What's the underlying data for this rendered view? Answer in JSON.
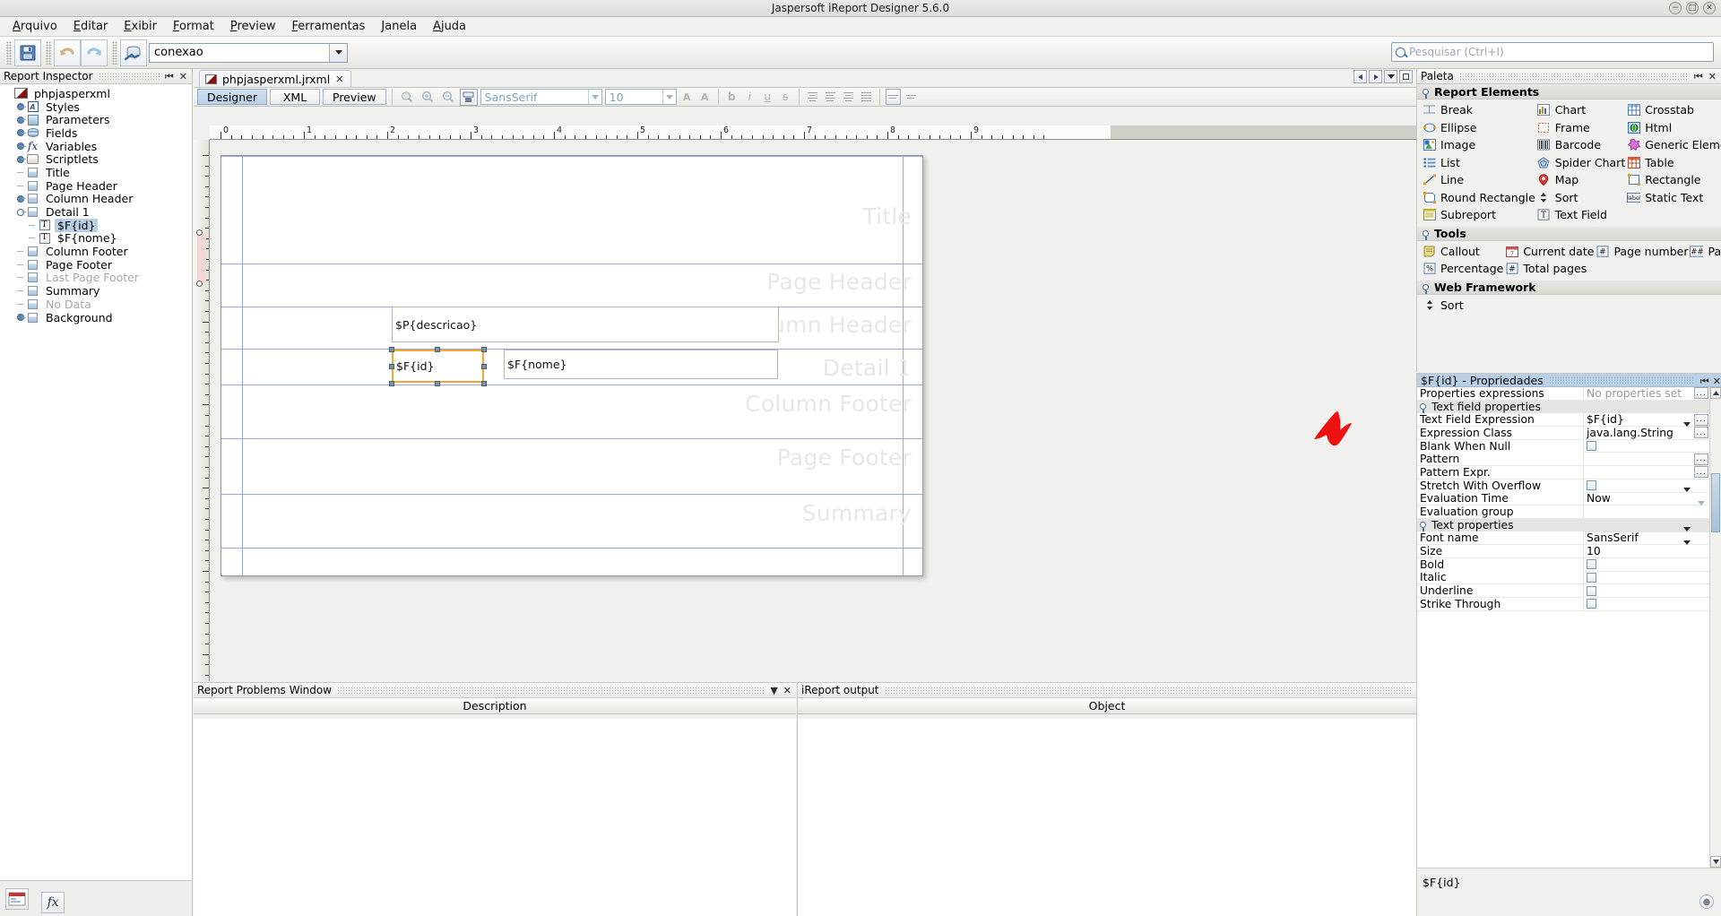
{
  "window": {
    "title": "Jaspersoft iReport Designer 5.6.0",
    "minimize_icon": "minimize-icon",
    "maximize_icon": "maximize-icon",
    "close_icon": "close-icon"
  },
  "menubar": {
    "items": [
      {
        "label": "Arquivo"
      },
      {
        "label": "Editar"
      },
      {
        "label": "Exibir"
      },
      {
        "label": "Format"
      },
      {
        "label": "Preview"
      },
      {
        "label": "Ferramentas"
      },
      {
        "label": "Janela"
      },
      {
        "label": "Ajuda"
      }
    ]
  },
  "toolbar": {
    "save_icon": "save-icon",
    "undo_icon": "undo-icon",
    "redo_icon": "redo-icon",
    "datasource_icon": "database-icon",
    "connection_value": "conexao",
    "connection_arrow": "chevron-down-icon",
    "search_placeholder": "Pesquisar (Ctrl+I)",
    "search_icon": "search-icon"
  },
  "inspector": {
    "title": "Report Inspector",
    "minimize_btn": "minimize-panel-icon",
    "close_btn": "close-panel-icon",
    "tree": [
      {
        "label": "phpjasperxml",
        "depth": 0,
        "icon": "report-icon",
        "handle": "none",
        "selected": false,
        "dim": false
      },
      {
        "label": "Styles",
        "depth": 1,
        "icon": "styles-icon",
        "handle": "closed",
        "selected": false,
        "dim": false
      },
      {
        "label": "Parameters",
        "depth": 1,
        "icon": "parameters-icon",
        "handle": "closed",
        "selected": false,
        "dim": false
      },
      {
        "label": "Fields",
        "depth": 1,
        "icon": "fields-icon",
        "handle": "closed",
        "selected": false,
        "dim": false
      },
      {
        "label": "Variables",
        "depth": 1,
        "icon": "variables-icon",
        "handle": "closed",
        "selected": false,
        "dim": false
      },
      {
        "label": "Scriptlets",
        "depth": 1,
        "icon": "scriptlets-icon",
        "handle": "closed",
        "selected": false,
        "dim": false
      },
      {
        "label": "Title",
        "depth": 1,
        "icon": "band-icon",
        "handle": "dash",
        "selected": false,
        "dim": false
      },
      {
        "label": "Page Header",
        "depth": 1,
        "icon": "band-icon",
        "handle": "dash",
        "selected": false,
        "dim": false
      },
      {
        "label": "Column Header",
        "depth": 1,
        "icon": "band-icon",
        "handle": "closed",
        "selected": false,
        "dim": false
      },
      {
        "label": "Detail 1",
        "depth": 1,
        "icon": "band-icon",
        "handle": "open",
        "selected": false,
        "dim": false
      },
      {
        "label": "$F{id}",
        "depth": 2,
        "icon": "textfield-icon",
        "handle": "dash",
        "selected": true,
        "dim": false
      },
      {
        "label": "$F{nome}",
        "depth": 2,
        "icon": "textfield-icon",
        "handle": "dash",
        "selected": false,
        "dim": false
      },
      {
        "label": "Column Footer",
        "depth": 1,
        "icon": "band-icon",
        "handle": "dash",
        "selected": false,
        "dim": false
      },
      {
        "label": "Page Footer",
        "depth": 1,
        "icon": "band-icon",
        "handle": "dash",
        "selected": false,
        "dim": false
      },
      {
        "label": "Last Page Footer",
        "depth": 1,
        "icon": "band-icon",
        "handle": "dash",
        "selected": false,
        "dim": true
      },
      {
        "label": "Summary",
        "depth": 1,
        "icon": "band-icon",
        "handle": "dash",
        "selected": false,
        "dim": false
      },
      {
        "label": "No Data",
        "depth": 1,
        "icon": "band-icon",
        "handle": "dash",
        "selected": false,
        "dim": true
      },
      {
        "label": "Background",
        "depth": 1,
        "icon": "band-icon",
        "handle": "closed",
        "selected": false,
        "dim": false
      }
    ],
    "footer_buttons": [
      "report-thumb-icon",
      "formula-icon"
    ]
  },
  "editor": {
    "tab": {
      "label": "phpjasperxml.jrxml",
      "doc_icon": "jrxml-file-icon",
      "close_icon": "close-tab-icon"
    },
    "tab_controls": [
      "prev-tab-icon",
      "next-tab-icon",
      "tab-list-icon",
      "maximize-editor-icon"
    ],
    "view_tabs": [
      {
        "label": "Designer",
        "active": true
      },
      {
        "label": "XML",
        "active": false
      },
      {
        "label": "Preview",
        "active": false
      }
    ],
    "zoom_buttons": [
      "zoom-fit-icon",
      "zoom-in-icon",
      "zoom-out-icon"
    ],
    "format_tool_icon": "format-painter-icon",
    "font_name": "SansSerif",
    "font_size": "10",
    "text_buttons": [
      "increase-font-icon",
      "decrease-font-icon",
      "bold-icon",
      "italic-icon",
      "underline-icon",
      "strikethrough-icon",
      "align-left-icon",
      "align-center-icon",
      "align-right-icon",
      "align-justify-icon",
      "valign-top-icon",
      "valign-middle-icon"
    ],
    "ruler": {
      "unit_labels": [
        "0",
        "1",
        "2",
        "3",
        "4",
        "5",
        "6",
        "7",
        "8",
        "9"
      ]
    }
  },
  "canvas": {
    "bands": [
      {
        "name": "Title",
        "label": "Title"
      },
      {
        "name": "Page Header",
        "label": "Page Header"
      },
      {
        "name": "Column Header",
        "label": "Column Header"
      },
      {
        "name": "Detail 1",
        "label": "Detail 1"
      },
      {
        "name": "Column Footer",
        "label": "Column Footer"
      },
      {
        "name": "Page Footer",
        "label": "Page Footer"
      },
      {
        "name": "Summary",
        "label": "Summary"
      }
    ],
    "elements": [
      {
        "name": "descricao-parameter-field",
        "text": "$P{descricao}",
        "selected": false
      },
      {
        "name": "id-field",
        "text": "$F{id}",
        "selected": true
      },
      {
        "name": "nome-field",
        "text": "$F{nome}",
        "selected": false
      }
    ],
    "annotation": {
      "name": "red-arrow-annotation",
      "color": "#ee1111"
    }
  },
  "problems_panel": {
    "title": "Report Problems Window",
    "minimize_btn": "minimize-panel-icon",
    "close_btn": "close-panel-icon",
    "column_header": "Description"
  },
  "output_panel": {
    "title": "iReport output",
    "column_header": "Object"
  },
  "palette": {
    "title": "Paleta",
    "minimize_btn": "minimize-panel-icon",
    "close_btn": "close-panel-icon",
    "sections": [
      {
        "title": "Report Elements",
        "columns": 3,
        "items": [
          {
            "label": "Break",
            "icon": "break-icon"
          },
          {
            "label": "Chart",
            "icon": "chart-icon"
          },
          {
            "label": "Crosstab",
            "icon": "crosstab-icon"
          },
          {
            "label": "Ellipse",
            "icon": "ellipse-icon"
          },
          {
            "label": "Frame",
            "icon": "frame-icon"
          },
          {
            "label": "Html",
            "icon": "html-icon"
          },
          {
            "label": "Image",
            "icon": "image-icon"
          },
          {
            "label": "Barcode",
            "icon": "barcode-icon"
          },
          {
            "label": "Generic Element",
            "icon": "generic-element-icon"
          },
          {
            "label": "List",
            "icon": "list-icon"
          },
          {
            "label": "Spider Chart",
            "icon": "spider-chart-icon"
          },
          {
            "label": "Table",
            "icon": "table-icon"
          },
          {
            "label": "Line",
            "icon": "line-icon"
          },
          {
            "label": "Map",
            "icon": "map-icon"
          },
          {
            "label": "Rectangle",
            "icon": "rectangle-icon"
          },
          {
            "label": "Round Rectangle",
            "icon": "round-rectangle-icon"
          },
          {
            "label": "Sort",
            "icon": "sort-icon"
          },
          {
            "label": "Static Text",
            "icon": "static-text-icon"
          },
          {
            "label": "Subreport",
            "icon": "subreport-icon"
          },
          {
            "label": "Text Field",
            "icon": "text-field-icon"
          }
        ]
      },
      {
        "title": "Tools",
        "columns": 4,
        "items": [
          {
            "label": "Callout",
            "icon": "callout-icon"
          },
          {
            "label": "Current date",
            "icon": "current-date-icon"
          },
          {
            "label": "Page number",
            "icon": "page-number-icon"
          },
          {
            "label": "Page X of Y",
            "icon": "page-x-of-y-icon"
          },
          {
            "label": "Percentage",
            "icon": "percentage-icon"
          },
          {
            "label": "Total pages",
            "icon": "total-pages-icon"
          }
        ]
      },
      {
        "title": "Web Framework",
        "columns": 4,
        "items": [
          {
            "label": "Sort",
            "icon": "sort-icon"
          }
        ]
      }
    ]
  },
  "properties": {
    "title": "$F{id} - Propriedades",
    "minimize_btn": "minimize-panel-icon",
    "close_btn": "close-panel-icon",
    "rows": [
      {
        "name": "Properties expressions",
        "value": "No properties set",
        "type": "text-muted",
        "dots": true
      },
      {
        "name": "Text field properties",
        "type": "group"
      },
      {
        "name": "Text Field Expression",
        "value": "$F{id}",
        "type": "text",
        "dots": true
      },
      {
        "name": "Expression Class",
        "value": "java.lang.String",
        "type": "combo",
        "dots": true
      },
      {
        "name": "Blank When Null",
        "value": "",
        "type": "checkbox"
      },
      {
        "name": "Pattern",
        "value": "",
        "type": "text",
        "dots": true
      },
      {
        "name": "Pattern Expr.",
        "value": "",
        "type": "text",
        "dots": true
      },
      {
        "name": "Stretch With Overflow",
        "value": "",
        "type": "checkbox"
      },
      {
        "name": "Evaluation Time",
        "value": "Now",
        "type": "combo"
      },
      {
        "name": "Evaluation group",
        "value": "",
        "type": "combo-disabled"
      },
      {
        "name": "Text properties",
        "type": "group"
      },
      {
        "name": "Font name",
        "value": "SansSerif",
        "type": "combo"
      },
      {
        "name": "Size",
        "value": "10",
        "type": "combo"
      },
      {
        "name": "Bold",
        "value": "",
        "type": "checkbox"
      },
      {
        "name": "Italic",
        "value": "",
        "type": "checkbox"
      },
      {
        "name": "Underline",
        "value": "",
        "type": "checkbox"
      },
      {
        "name": "Strike Through",
        "value": "",
        "type": "checkbox"
      }
    ],
    "footer_label": "$F{id}",
    "help_icon": "help-icon"
  }
}
